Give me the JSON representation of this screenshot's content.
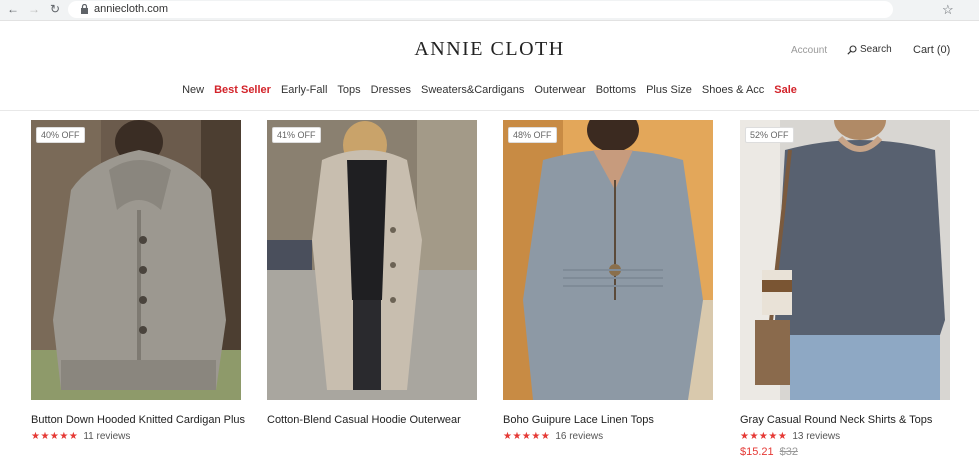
{
  "browser": {
    "url": "anniecloth.com"
  },
  "header": {
    "logo": "ANNIE CLOTH",
    "account": "Account",
    "search": "Search",
    "cart": "Cart (0)"
  },
  "nav": {
    "items": [
      {
        "label": "New",
        "hot": false
      },
      {
        "label": "Best Seller",
        "hot": true
      },
      {
        "label": "Early-Fall",
        "hot": false
      },
      {
        "label": "Tops",
        "hot": false
      },
      {
        "label": "Dresses",
        "hot": false
      },
      {
        "label": "Sweaters&Cardigans",
        "hot": false
      },
      {
        "label": "Outerwear",
        "hot": false
      },
      {
        "label": "Bottoms",
        "hot": false
      },
      {
        "label": "Plus Size",
        "hot": false
      },
      {
        "label": "Shoes & Acc",
        "hot": false
      },
      {
        "label": "Sale",
        "hot": true
      }
    ],
    "hot_color": "#d3232a"
  },
  "products": [
    {
      "badge": "40% OFF",
      "name": "Button Down Hooded Knitted Cardigan Plus",
      "stars": "★★★★★",
      "reviews": "11 reviews",
      "price": "",
      "old_price": ""
    },
    {
      "badge": "41% OFF",
      "name": "Cotton-Blend Casual Hoodie Outerwear",
      "stars": "★★★★★",
      "reviews": "",
      "price": "",
      "old_price": ""
    },
    {
      "badge": "48% OFF",
      "name": "Boho Guipure Lace Linen Tops",
      "stars": "★★★★★",
      "reviews": "16 reviews",
      "price": "",
      "old_price": ""
    },
    {
      "badge": "52% OFF",
      "name": "Gray Casual Round Neck Shirts & Tops",
      "stars": "★★★★★",
      "reviews": "13 reviews",
      "price": "$15.21",
      "old_price": "$32"
    }
  ],
  "colors": {
    "star": "#e53935",
    "price": "#e53935"
  }
}
